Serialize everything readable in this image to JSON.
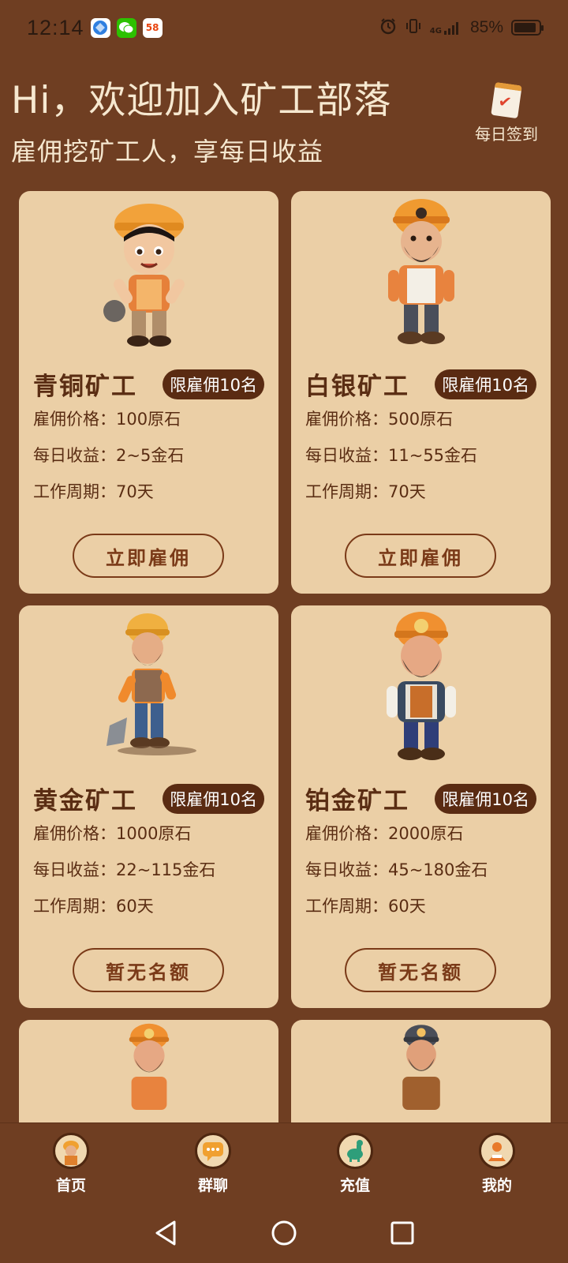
{
  "status_bar": {
    "time": "12:14",
    "apps": [
      "browser-app-icon",
      "wechat-app-icon",
      "58-app-icon"
    ],
    "app_58_text": "58",
    "signal": "4G",
    "battery": "85%"
  },
  "header": {
    "greeting": "Hi，欢迎加入矿工部落",
    "subtitle": "雇佣挖矿工人，享每日收益",
    "checkin_label": "每日签到"
  },
  "miners": [
    {
      "name": "青铜矿工",
      "badge": "限雇佣10名",
      "price": "雇佣价格：100原石",
      "income": "每日收益：2~5金石",
      "period": "工作周期：70天",
      "button": "立即雇佣"
    },
    {
      "name": "白银矿工",
      "badge": "限雇佣10名",
      "price": "雇佣价格：500原石",
      "income": "每日收益：11~55金石",
      "period": "工作周期：70天",
      "button": "立即雇佣"
    },
    {
      "name": "黄金矿工",
      "badge": "限雇佣10名",
      "price": "雇佣价格：1000原石",
      "income": "每日收益：22~115金石",
      "period": "工作周期：60天",
      "button": "暂无名额"
    },
    {
      "name": "铂金矿工",
      "badge": "限雇佣10名",
      "price": "雇佣价格：2000原石",
      "income": "每日收益：45~180金石",
      "period": "工作周期：60天",
      "button": "暂无名额"
    }
  ],
  "nav": [
    {
      "label": "首页",
      "icon": "miner-home-icon"
    },
    {
      "label": "群聊",
      "icon": "chat-icon"
    },
    {
      "label": "充值",
      "icon": "dinosaur-icon"
    },
    {
      "label": "我的",
      "icon": "person-icon"
    }
  ],
  "colors": {
    "background": "#6f3e22",
    "card": "#ebcfa6",
    "text_dark": "#5a2d13",
    "badge": "#5a2b12"
  }
}
